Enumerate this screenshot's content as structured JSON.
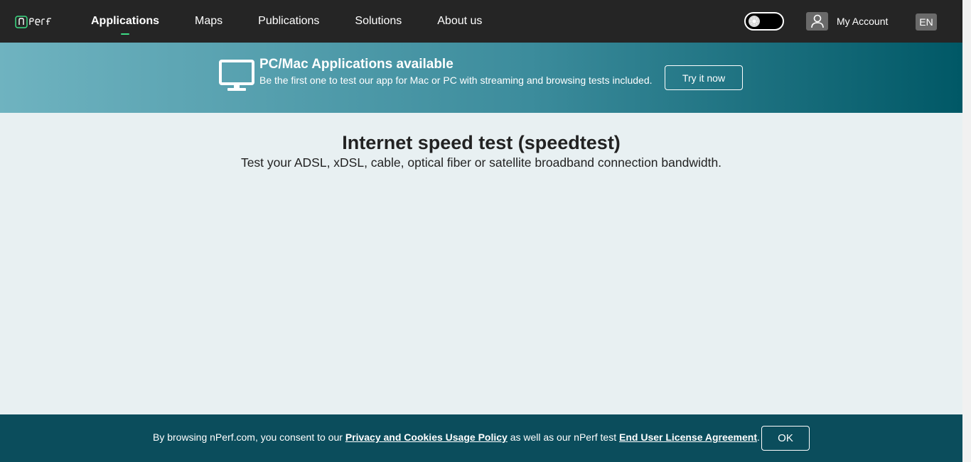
{
  "header": {
    "logo_icon": "nperf-logo",
    "nav": [
      {
        "label": "Applications",
        "active": true
      },
      {
        "label": "Maps"
      },
      {
        "label": "Publications"
      },
      {
        "label": "Solutions"
      },
      {
        "label": "About us"
      }
    ],
    "theme_toggle_icon": "sun-icon",
    "account_label": "My Account",
    "account_icon": "user-icon",
    "language": "EN"
  },
  "banner": {
    "icon": "monitor-icon",
    "title": "PC/Mac Applications available",
    "subtitle": "Be the first one to test our app for Mac or PC with streaming and browsing tests included.",
    "button_label": "Try it now"
  },
  "main": {
    "title": "Internet speed test (speedtest)",
    "subtitle": "Test your ADSL, xDSL, cable, optical fiber or satellite broadband connection bandwidth."
  },
  "cookie": {
    "text_1": "By browsing nPerf.com, you consent to our ",
    "link_1": "Privacy and Cookies Usage Policy",
    "text_2": " as well as our nPerf test ",
    "link_2": "End User License Agreement",
    "text_3": ".",
    "button_label": "OK"
  },
  "colors": {
    "header_bg": "#252525",
    "accent": "#3ddc84",
    "banner_end": "#005866",
    "cookie_bg": "#0b4d5c",
    "page_bg": "#e8f0f2"
  }
}
